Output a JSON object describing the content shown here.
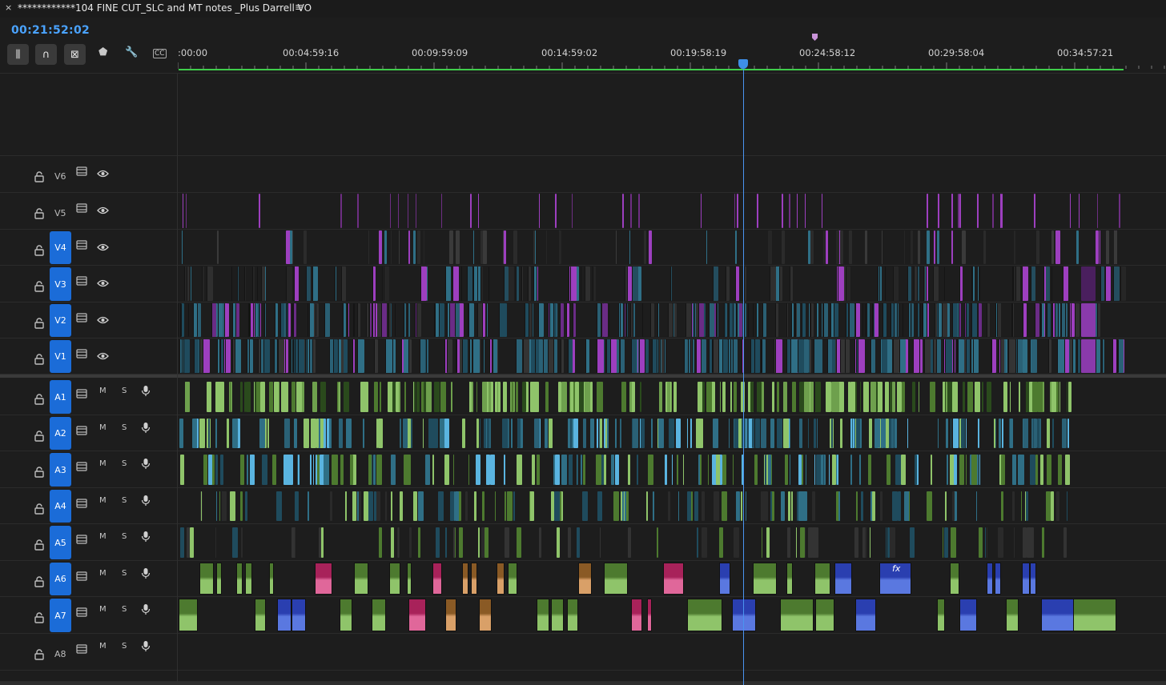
{
  "window": {
    "close_glyph": "×",
    "title": "************104 FINE CUT_SLC and MT notes _Plus Darrell VO",
    "menu_glyph": "≡"
  },
  "timecode": "00:21:52:02",
  "toolbar": [
    {
      "name": "insert-overwrite-toggle-button",
      "icon": "nest-icon",
      "glyph": "⫼"
    },
    {
      "name": "snap-button",
      "icon": "magnet-icon",
      "glyph": "∩"
    },
    {
      "name": "linked-selection-button",
      "icon": "linked-selection-icon",
      "glyph": "⊠"
    },
    {
      "name": "add-marker-button",
      "icon": "marker-icon",
      "glyph": "⬟"
    },
    {
      "name": "timeline-settings-button",
      "icon": "wrench-icon",
      "glyph": "🔧"
    },
    {
      "name": "captions-button",
      "icon": "captions-icon",
      "glyph": "CC"
    }
  ],
  "ruler": {
    "labels": [
      ":00:00",
      "00:04:59:16",
      "00:09:59:09",
      "00:14:59:02",
      "00:19:58:19",
      "00:24:58:12",
      "00:29:58:04",
      "00:34:57:21"
    ]
  },
  "colors": {
    "accent": "#4aa3ff",
    "target": "#1b6cd8",
    "workbar": "#3fce4b",
    "playhead": "#4a94f0",
    "marker": "#c993d8",
    "clip_teal": "#2f6f86",
    "clip_purple": "#9d3fbf",
    "clip_green": "#8fc46a",
    "clip_pink": "#e0679a",
    "clip_orange": "#d9a068",
    "clip_blue": "#5a78e0"
  },
  "video_tracks": [
    {
      "id": "V6",
      "targeted": false
    },
    {
      "id": "V5",
      "targeted": false
    },
    {
      "id": "V4",
      "targeted": true
    },
    {
      "id": "V3",
      "targeted": true
    },
    {
      "id": "V2",
      "targeted": true
    },
    {
      "id": "V1",
      "targeted": true
    }
  ],
  "audio_tracks": [
    {
      "id": "A1",
      "targeted": true
    },
    {
      "id": "A2",
      "targeted": true
    },
    {
      "id": "A3",
      "targeted": true
    },
    {
      "id": "A4",
      "targeted": true
    },
    {
      "id": "A5",
      "targeted": true
    },
    {
      "id": "A6",
      "targeted": true
    },
    {
      "id": "A7",
      "targeted": true
    },
    {
      "id": "A8",
      "targeted": false
    }
  ],
  "audio_controls": {
    "mute": "M",
    "solo": "S"
  },
  "fx_badge": "fx"
}
